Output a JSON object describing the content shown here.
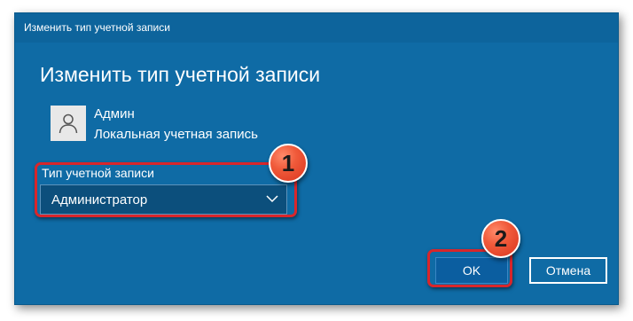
{
  "window": {
    "title": "Изменить тип учетной записи"
  },
  "dialog": {
    "heading": "Изменить тип учетной записи",
    "user": {
      "name": "Админ",
      "type": "Локальная учетная запись",
      "avatar_icon": "user-icon"
    },
    "account_type": {
      "label": "Тип учетной записи",
      "selected": "Администратор"
    },
    "buttons": {
      "ok": "OK",
      "cancel": "Отмена"
    }
  },
  "annotations": {
    "badge_1": "1",
    "badge_2": "2"
  },
  "colors": {
    "dialog_bg": "#0f6ba5",
    "highlight": "#d8262b",
    "badge": "#f05a3a"
  }
}
